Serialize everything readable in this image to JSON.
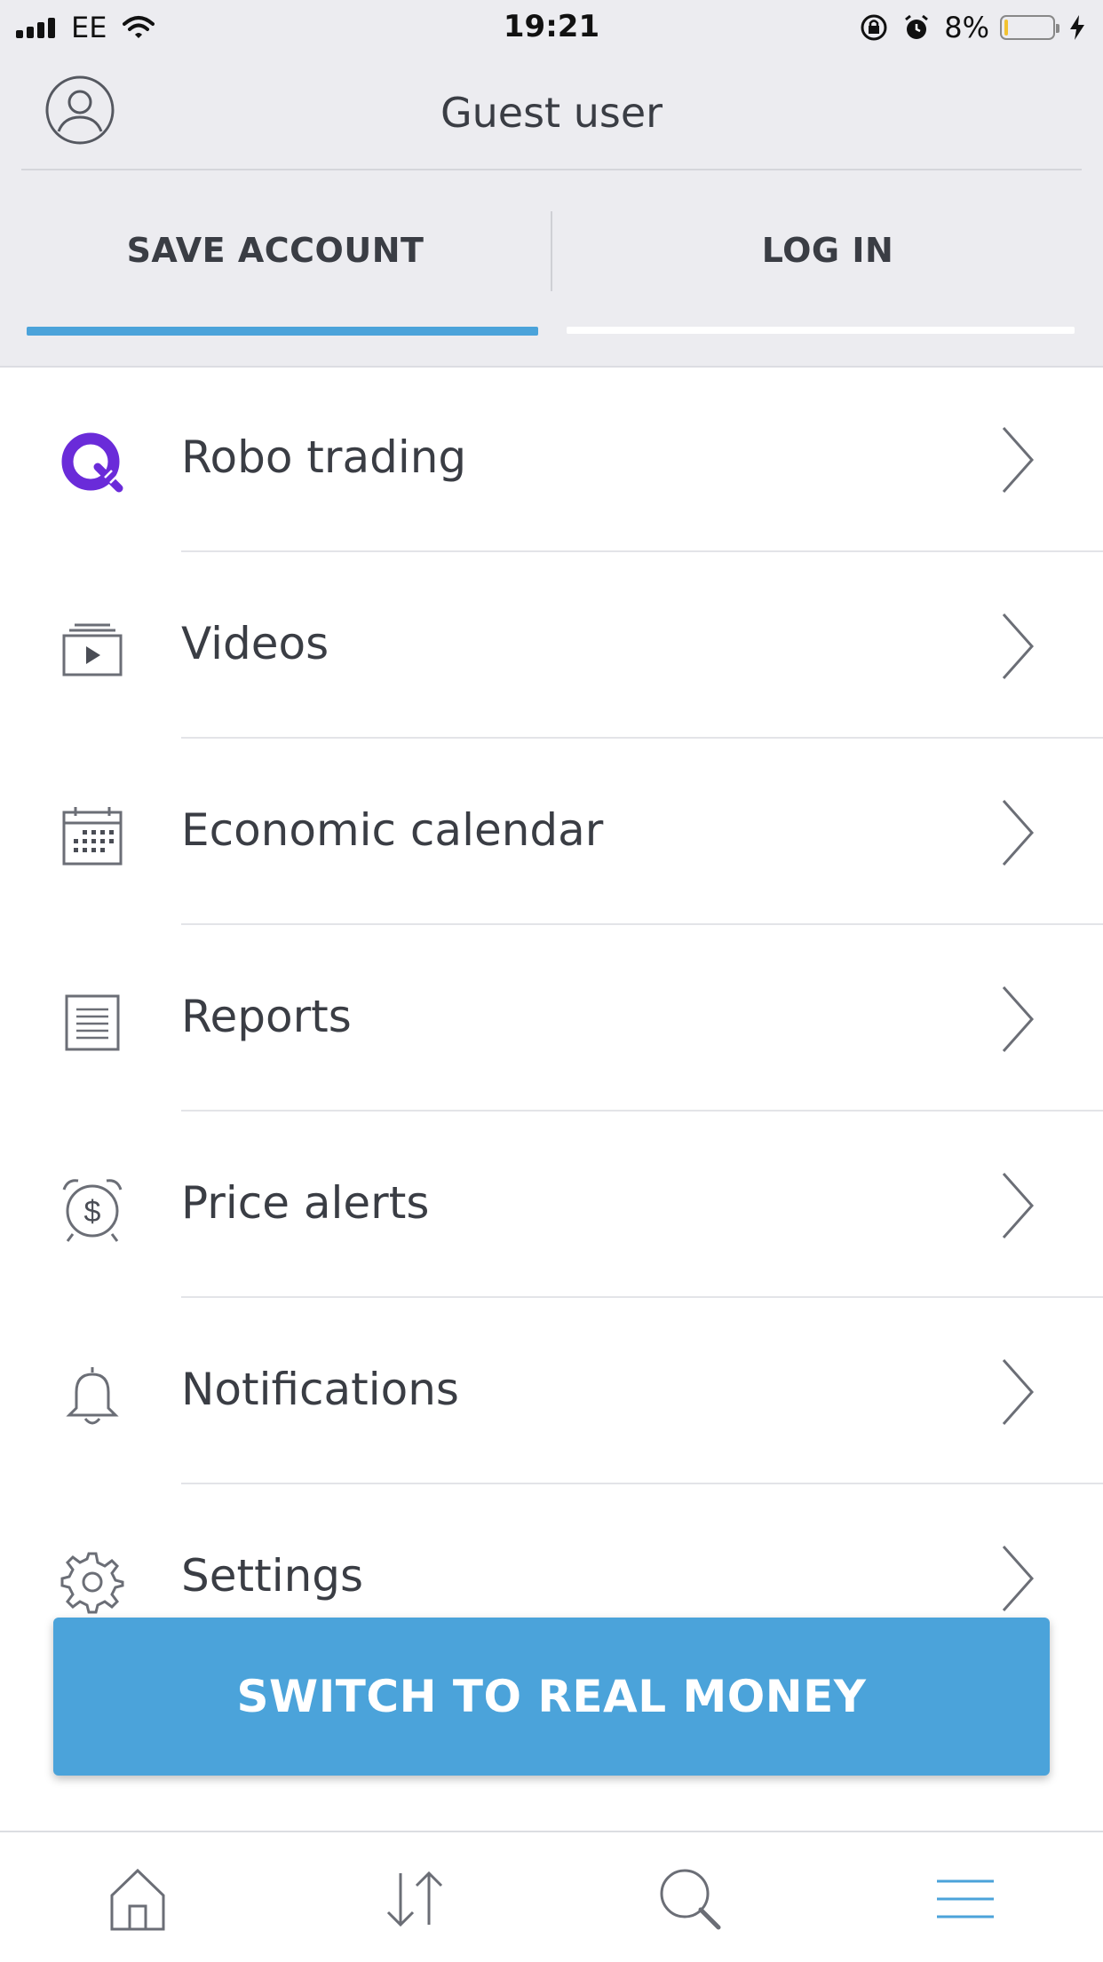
{
  "status_bar": {
    "carrier": "EE",
    "time": "19:21",
    "battery_percent": "8%",
    "battery_level": 0.08,
    "icons": [
      "signal-icon",
      "wifi-icon",
      "orientation-lock-icon",
      "alarm-icon",
      "battery-icon",
      "charging-icon"
    ]
  },
  "header": {
    "user_name": "Guest user",
    "avatar_icon": "user-avatar-icon",
    "save_account_label": "SAVE ACCOUNT",
    "login_label": "LOG IN",
    "active_tab": "SAVE ACCOUNT"
  },
  "menu": {
    "items": [
      {
        "label": "Robo trading",
        "icon": "robo-trading-icon"
      },
      {
        "label": "Videos",
        "icon": "video-icon"
      },
      {
        "label": "Economic calendar",
        "icon": "calendar-icon"
      },
      {
        "label": "Reports",
        "icon": "reports-icon"
      },
      {
        "label": "Price alerts",
        "icon": "price-alert-icon"
      },
      {
        "label": "Notifications",
        "icon": "bell-icon"
      },
      {
        "label": "Settings",
        "icon": "gear-icon"
      }
    ]
  },
  "cta": {
    "label": "SWITCH TO REAL MONEY"
  },
  "tabbar": {
    "tabs": [
      "home-icon",
      "trade-arrows-icon",
      "search-icon",
      "menu-icon"
    ],
    "active": "menu-icon"
  },
  "colors": {
    "accent": "#4ba3da",
    "robo_purple": "#6a2bd9",
    "header_bg": "#ececf0",
    "text": "#3a3d44",
    "icon_gray": "#6b6e76"
  }
}
